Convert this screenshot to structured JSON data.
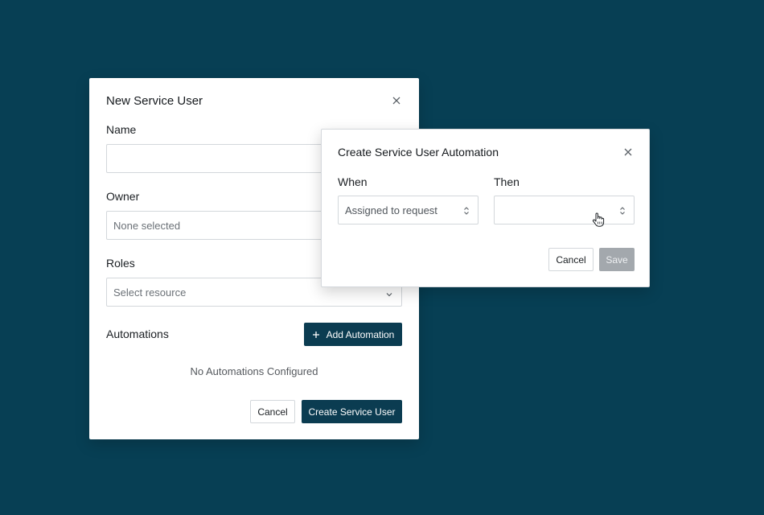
{
  "new_service_user": {
    "title": "New Service User",
    "name_label": "Name",
    "name_value": "",
    "owner_label": "Owner",
    "owner_placeholder": "None selected",
    "roles_label": "Roles",
    "roles_placeholder": "Select resource",
    "automations_label": "Automations",
    "add_automation_label": "Add Automation",
    "empty_automations": "No Automations Configured",
    "cancel_label": "Cancel",
    "create_label": "Create Service User"
  },
  "automation_dialog": {
    "title": "Create Service User Automation",
    "when_label": "When",
    "when_value": "Assigned to request",
    "then_label": "Then",
    "then_value": "",
    "cancel_label": "Cancel",
    "save_label": "Save"
  },
  "colors": {
    "background": "#073f54",
    "primary_button": "#0b3c51",
    "disabled_button": "#a3a8ad"
  },
  "icons": {
    "close": "close-icon",
    "plus": "plus-icon",
    "chevron": "chevron-down-icon",
    "select_arrows": "select-arrows-icon",
    "cursor": "hand-pointer-icon"
  }
}
